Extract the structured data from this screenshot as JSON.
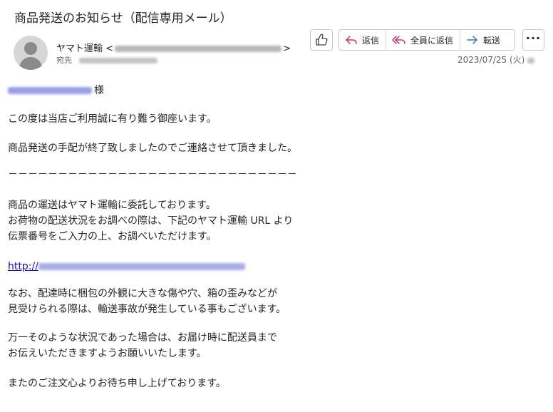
{
  "email": {
    "subject": "商品発送のお知らせ（配信専用メール）",
    "sender_name": "ヤマト運輸",
    "sender_open": "<",
    "sender_close": ">",
    "recipient_label": "宛先",
    "date": "2023/07/25 (火)",
    "accent_color": "#5b5fc7"
  },
  "toolbar": {
    "like_icon": "thumbs-up-icon",
    "reply_label": "返信",
    "reply_all_label": "全員に返信",
    "forward_label": "転送",
    "more_icon": "more-horizontal-icon",
    "more_glyph": "···"
  },
  "body": {
    "greeting_suffix": "様",
    "line1": "この度は当店ご利用誠に有り難う御座います。",
    "line2": "商品発送の手配が終了致しましたのでご連絡させて頂きました。",
    "separator": "－－－－－－－－－－－－－－－－－－－－－－－－－－－－－",
    "line3a": "商品の運送はヤマト運輸に委託しております。",
    "line3b": "お荷物の配送状況をお調べの際は、下記のヤマト運輸 URL より",
    "line3c": "伝票番号をご入力の上、お調べいただけます。",
    "link_prefix": "http://",
    "line4a": "なお、配達時に梱包の外観に大きな傷や穴、箱の歪みなどが",
    "line4b": "見受けられる際は、輸送事故が発生している事もございます。",
    "line5a": "万一そのような状況であった場合は、お届け時に配送員まで",
    "line5b": "お伝えいただきますようお願いいたします。",
    "line6": "またのご注文心よりお待ち申し上げております。"
  }
}
